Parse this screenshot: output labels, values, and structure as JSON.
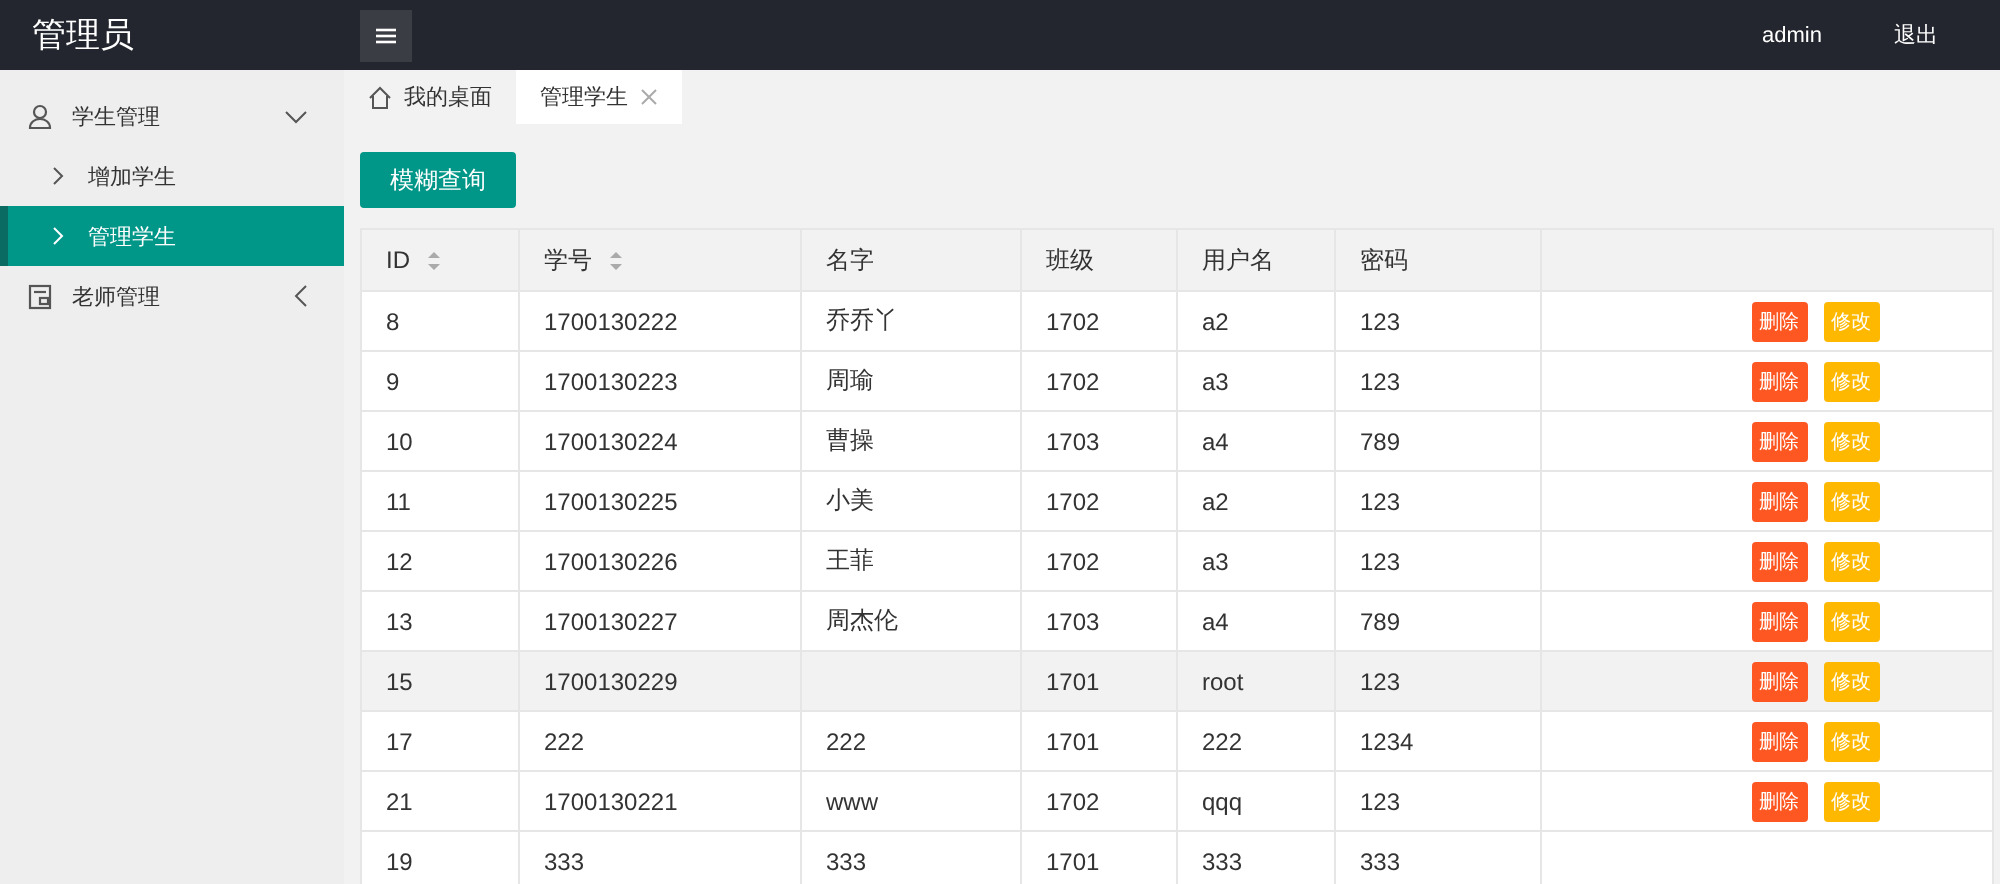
{
  "header": {
    "title": "管理员",
    "user": "admin",
    "logout": "退出"
  },
  "sidebar": {
    "items": [
      {
        "label": "学生管理",
        "expanded": true,
        "children": [
          {
            "label": "增加学生",
            "selected": false
          },
          {
            "label": "管理学生",
            "selected": true
          }
        ]
      },
      {
        "label": "老师管理",
        "expanded": false
      }
    ]
  },
  "tabs": [
    {
      "label": "我的桌面",
      "kind": "home",
      "selected": false
    },
    {
      "label": "管理学生",
      "kind": "closable",
      "selected": true
    }
  ],
  "search_button": "模糊查询",
  "table": {
    "columns": [
      {
        "label": "ID",
        "sortable": true
      },
      {
        "label": "学号",
        "sortable": true
      },
      {
        "label": "名字",
        "sortable": false
      },
      {
        "label": "班级",
        "sortable": false
      },
      {
        "label": "用户名",
        "sortable": false
      },
      {
        "label": "密码",
        "sortable": false
      }
    ],
    "rows": [
      {
        "cells": [
          "8",
          "1700130222",
          "乔乔丫",
          "1702",
          "a2",
          "123"
        ],
        "highlighted": false,
        "actions": [
          "删除",
          "修改"
        ]
      },
      {
        "cells": [
          "9",
          "1700130223",
          "周瑜",
          "1702",
          "a3",
          "123"
        ],
        "highlighted": false,
        "actions": [
          "删除",
          "修改"
        ]
      },
      {
        "cells": [
          "10",
          "1700130224",
          "曹操",
          "1703",
          "a4",
          "789"
        ],
        "highlighted": false,
        "actions": [
          "删除",
          "修改"
        ]
      },
      {
        "cells": [
          "11",
          "1700130225",
          "小美",
          "1702",
          "a2",
          "123"
        ],
        "highlighted": false,
        "actions": [
          "删除",
          "修改"
        ]
      },
      {
        "cells": [
          "12",
          "1700130226",
          "王菲",
          "1702",
          "a3",
          "123"
        ],
        "highlighted": false,
        "actions": [
          "删除",
          "修改"
        ]
      },
      {
        "cells": [
          "13",
          "1700130227",
          "周杰伦",
          "1703",
          "a4",
          "789"
        ],
        "highlighted": false,
        "actions": [
          "删除",
          "修改"
        ]
      },
      {
        "cells": [
          "15",
          "1700130229",
          "",
          "1701",
          "root",
          "123"
        ],
        "highlighted": true,
        "actions": [
          "删除",
          "修改"
        ]
      },
      {
        "cells": [
          "17",
          "222",
          "222",
          "1701",
          "222",
          "1234"
        ],
        "highlighted": false,
        "actions": [
          "删除",
          "修改"
        ]
      },
      {
        "cells": [
          "21",
          "1700130221",
          "www",
          "1702",
          "qqq",
          "123"
        ],
        "highlighted": false,
        "actions": [
          "删除",
          "修改"
        ]
      },
      {
        "cells": [
          "19",
          "333",
          "333",
          "1701",
          "333",
          "333"
        ],
        "highlighted": false,
        "actions": []
      }
    ]
  }
}
